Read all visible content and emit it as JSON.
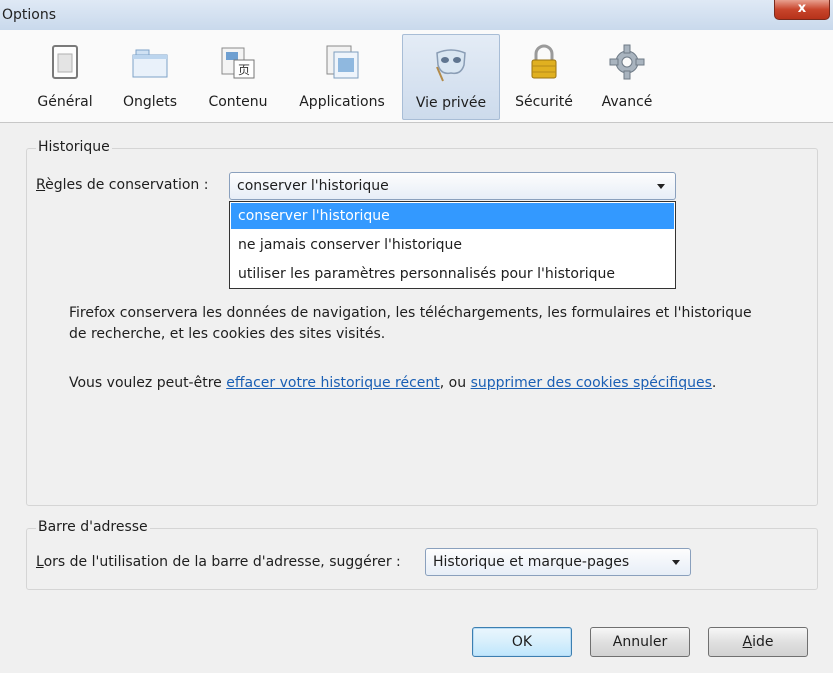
{
  "window": {
    "title": "Options",
    "close_glyph": "x"
  },
  "toolbar": {
    "panes": [
      {
        "id": "general",
        "label": "Général",
        "icon": "window-icon"
      },
      {
        "id": "tabs",
        "label": "Onglets",
        "icon": "tabs-icon"
      },
      {
        "id": "content",
        "label": "Contenu",
        "icon": "content-icon"
      },
      {
        "id": "applications",
        "label": "Applications",
        "icon": "applications-icon"
      },
      {
        "id": "privacy",
        "label": "Vie privée",
        "icon": "mask-icon",
        "selected": true
      },
      {
        "id": "security",
        "label": "Sécurité",
        "icon": "padlock-icon"
      },
      {
        "id": "advanced",
        "label": "Avancé",
        "icon": "gear-icon"
      }
    ]
  },
  "history": {
    "group_label": "Historique",
    "rules_label_first": "R",
    "rules_label_rest": "ègles de conservation :",
    "selected_value": "conserver l'historique",
    "options": [
      "conserver l'historique",
      "ne jamais conserver l'historique",
      "utiliser les paramètres personnalisés pour l'historique"
    ],
    "description": "Firefox conservera les données de navigation, les téléchargements, les formulaires et l'historique de recherche, et les cookies des sites visités.",
    "suggest_prefix": "Vous voulez peut-être ",
    "clear_link": "effacer votre historique récent",
    "suggest_middle": ", ou ",
    "cookies_link": "supprimer des cookies spécifiques",
    "suggest_suffix": "."
  },
  "addressbar": {
    "group_label": "Barre d'adresse",
    "suggest_label_first": "L",
    "suggest_label_rest": "ors de l'utilisation de la barre d'adresse, suggérer :",
    "selected_value": "Historique et marque-pages"
  },
  "buttons": {
    "ok": "OK",
    "cancel": "Annuler",
    "help_first": "A",
    "help_rest": "ide"
  },
  "colors": {
    "selection": "#3399ff",
    "link": "#1a5fb4"
  }
}
